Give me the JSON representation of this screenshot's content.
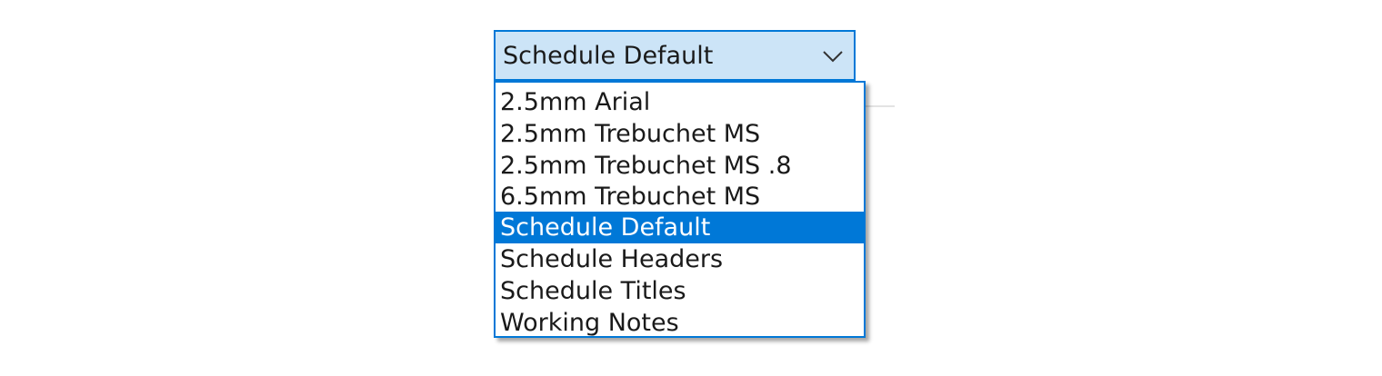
{
  "combo": {
    "value": "Schedule Default",
    "arrow_icon": "chevron-down-icon"
  },
  "dropdown": {
    "selected_index": 4,
    "options": [
      "2.5mm Arial",
      "2.5mm Trebuchet MS",
      "2.5mm Trebuchet MS .8",
      "6.5mm Trebuchet MS",
      "Schedule Default",
      "Schedule Headers",
      "Schedule Titles",
      "Working Notes"
    ]
  },
  "colors": {
    "accent": "#0078d7",
    "combo_background": "#cce4f7",
    "selected_text": "#ffffff"
  }
}
